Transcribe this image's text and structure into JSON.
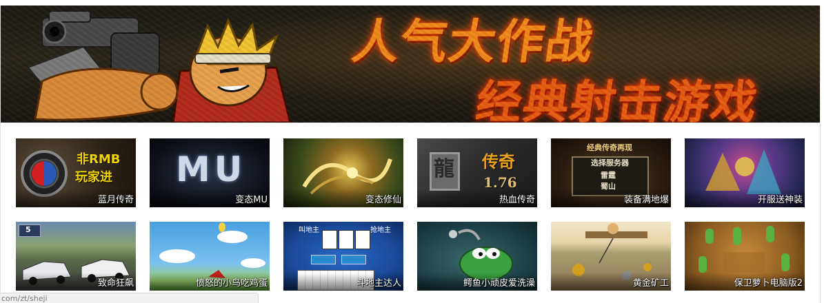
{
  "banner": {
    "title": "人气大作战",
    "subtitle": "经典射击游戏"
  },
  "games": [
    {
      "name": "蓝月传奇",
      "art_text": [
        "非RMB",
        "玩家进"
      ]
    },
    {
      "name": "变态MU",
      "art_text": [
        "MU"
      ]
    },
    {
      "name": "变态修仙",
      "art_text": []
    },
    {
      "name": "热血传奇",
      "art_text": [
        "龍",
        "传奇",
        "1.76"
      ]
    },
    {
      "name": "装备满地爆",
      "art_text": [
        "经典传奇再现",
        "选择服务器",
        "雷霆",
        "蜀山"
      ]
    },
    {
      "name": "开服送神装",
      "art_text": []
    },
    {
      "name": "致命狂飙",
      "art_text": [
        "5"
      ]
    },
    {
      "name": "愤怒的小鸟吃鸡蛋",
      "art_text": []
    },
    {
      "name": "斗地主达人",
      "art_text": [
        "叫地主",
        "抢地主"
      ]
    },
    {
      "name": "鳄鱼小顽皮爱洗澡",
      "art_text": []
    },
    {
      "name": "黄金矿工",
      "art_text": []
    },
    {
      "name": "保卫萝卜电脑版2",
      "art_text": []
    }
  ],
  "status_bar": {
    "url": "com/zt/sheji"
  }
}
